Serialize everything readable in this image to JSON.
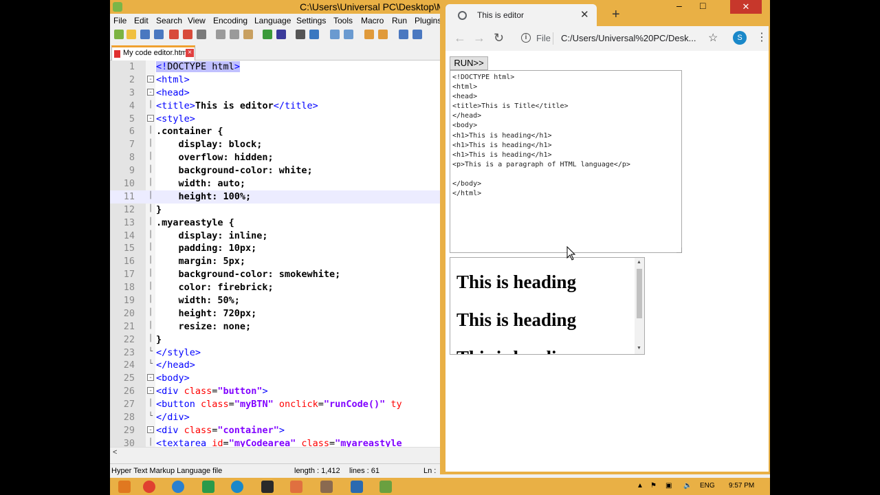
{
  "notepad": {
    "title": "C:\\Users\\Universal PC\\Desktop\\M",
    "menu": [
      "File",
      "Edit",
      "Search",
      "View",
      "Encoding",
      "Language",
      "Settings",
      "Tools",
      "Macro",
      "Run",
      "Plugins"
    ],
    "tab_label": "My code editor.html",
    "status": {
      "file_type": "Hyper Text Markup Language file",
      "length": "length : 1,412",
      "lines": "lines : 61",
      "ln": "Ln :"
    },
    "lines": [
      {
        "n": "1"
      },
      {
        "n": "2"
      },
      {
        "n": "3"
      },
      {
        "n": "4"
      },
      {
        "n": "5"
      },
      {
        "n": "6"
      },
      {
        "n": "7"
      },
      {
        "n": "8"
      },
      {
        "n": "9"
      },
      {
        "n": "10"
      },
      {
        "n": "11"
      },
      {
        "n": "12"
      },
      {
        "n": "13"
      },
      {
        "n": "14"
      },
      {
        "n": "15"
      },
      {
        "n": "16"
      },
      {
        "n": "17"
      },
      {
        "n": "18"
      },
      {
        "n": "19"
      },
      {
        "n": "20"
      },
      {
        "n": "21"
      },
      {
        "n": "22"
      },
      {
        "n": "23"
      },
      {
        "n": "24"
      },
      {
        "n": "25"
      },
      {
        "n": "26"
      },
      {
        "n": "27"
      },
      {
        "n": "28"
      },
      {
        "n": "29"
      },
      {
        "n": "30"
      }
    ],
    "code": {
      "l1": "DOCTYPE html",
      "l2_tag": "<html>",
      "l3_tag": "<head>",
      "l4_open": "<title>",
      "l4_text": "This is editor",
      "l4_close": "</title>",
      "l5_tag": "<style>",
      "l6": ".container {",
      "l7": "    display: block;",
      "l8": "    overflow: hidden;",
      "l9": "    background-color: white;",
      "l10": "    width: auto;",
      "l11": "    height: 100%;",
      "l12": "}",
      "l13": ".myareastyle {",
      "l14": "    display: inline;",
      "l15": "    padding: 10px;",
      "l16": "    margin: 5px;",
      "l17": "    background-color: smokewhite;",
      "l18": "    color: firebrick;",
      "l19": "    width: 50%;",
      "l20": "    height: 720px;",
      "l21": "    resize: none;",
      "l22": "}",
      "l23_tag": "</style>",
      "l24_tag": "</head>",
      "l25_tag": "<body>",
      "l26_open": "<div ",
      "l26_attr": "class",
      "l26_eq": "=",
      "l26_val": "\"button\"",
      "l26_close": ">",
      "l27_open": "<button ",
      "l27_attr1": "class",
      "l27_eq": "=",
      "l27_val1": "\"myBTN\"",
      "l27_attr2": " onclick",
      "l27_val2": "\"runCode()\"",
      "l27_tail": " ty",
      "l28_tag": "</div>",
      "l29_open": "<div ",
      "l29_attr": "class",
      "l29_val": "\"container\"",
      "l29_close": ">",
      "l30_open": "<textarea ",
      "l30_attr1": "id",
      "l30_val1": "\"myCodearea\"",
      "l30_attr2": " class",
      "l30_val2": "\"myareastyle"
    }
  },
  "chrome": {
    "tab_title": "This is editor",
    "url_scheme": "File",
    "url": "C:/Users/Universal%20PC/Desk...",
    "avatar_letter": "S",
    "run_button": "RUN>>",
    "textarea_content": "<!DOCTYPE html>\n<html>\n<head>\n<title>This is Title</title>\n</head>\n<body>\n<h1>This is heading</h1>\n<h1>This is heading</h1>\n<h1>This is heading</h1>\n<p>This is a paragraph of HTML language</p>\n\n</body>\n</html>",
    "preview_headings": [
      "This is heading",
      "This is heading",
      "This is heading"
    ]
  },
  "taskbar": {
    "language": "ENG",
    "time": "9:57 PM"
  }
}
